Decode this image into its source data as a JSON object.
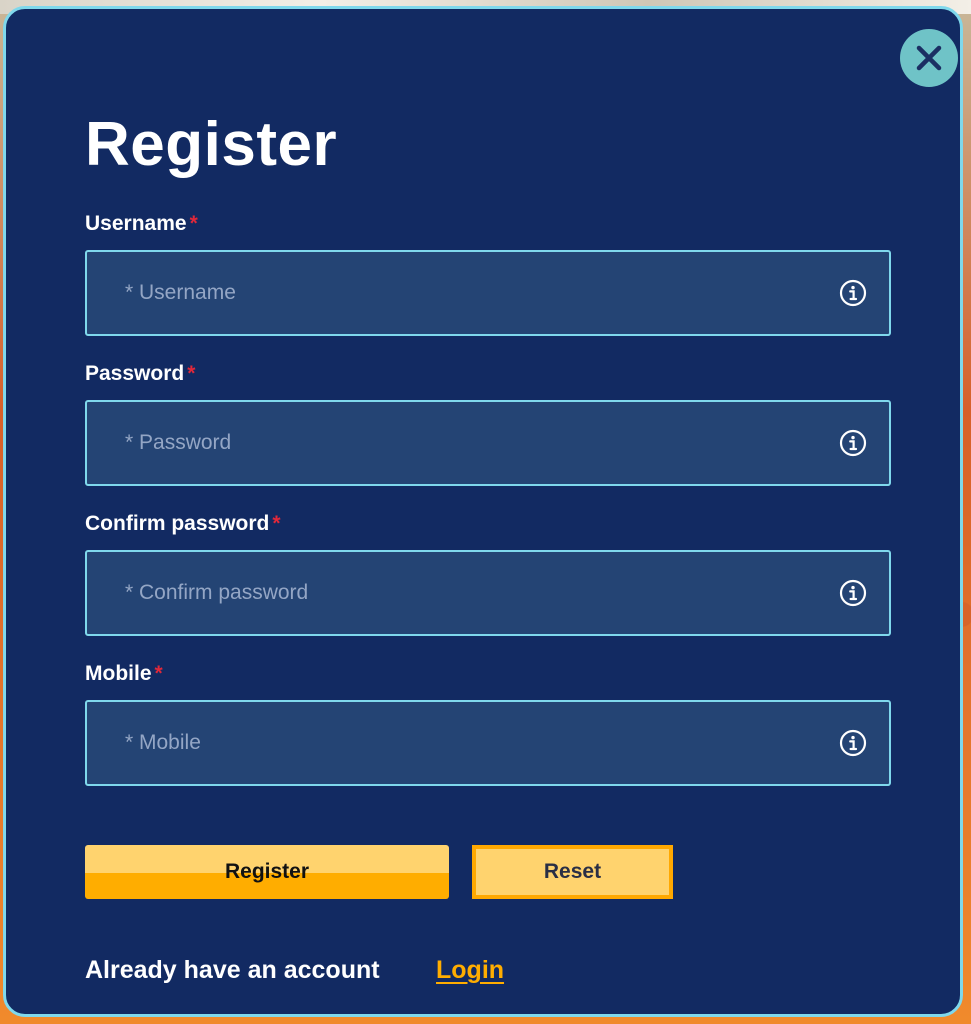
{
  "modal": {
    "title": "Register",
    "close_icon": "close-icon",
    "fields": [
      {
        "label": "Username",
        "required_mark": "*",
        "placeholder": "* Username",
        "value": "",
        "icon": "info-icon"
      },
      {
        "label": "Password",
        "required_mark": "*",
        "placeholder": "* Password",
        "value": "",
        "icon": "info-icon"
      },
      {
        "label": "Confirm password",
        "required_mark": "*",
        "placeholder": "* Confirm password",
        "value": "",
        "icon": "info-icon"
      },
      {
        "label": "Mobile",
        "required_mark": "*",
        "placeholder": "* Mobile",
        "value": "",
        "icon": "info-icon"
      }
    ],
    "buttons": {
      "register_label": "Register",
      "reset_label": "Reset"
    },
    "footer": {
      "account_text": "Already have an account",
      "login_label": "Login"
    }
  },
  "colors": {
    "modal_background": "#122a62",
    "border_accent": "#7fd8ec",
    "input_background": "#244474",
    "required_mark": "#e0283a",
    "primary_button": "#ffad00",
    "primary_button_light": "#ffd36e",
    "close_button": "#6fc3c7",
    "link": "#ffad00"
  }
}
